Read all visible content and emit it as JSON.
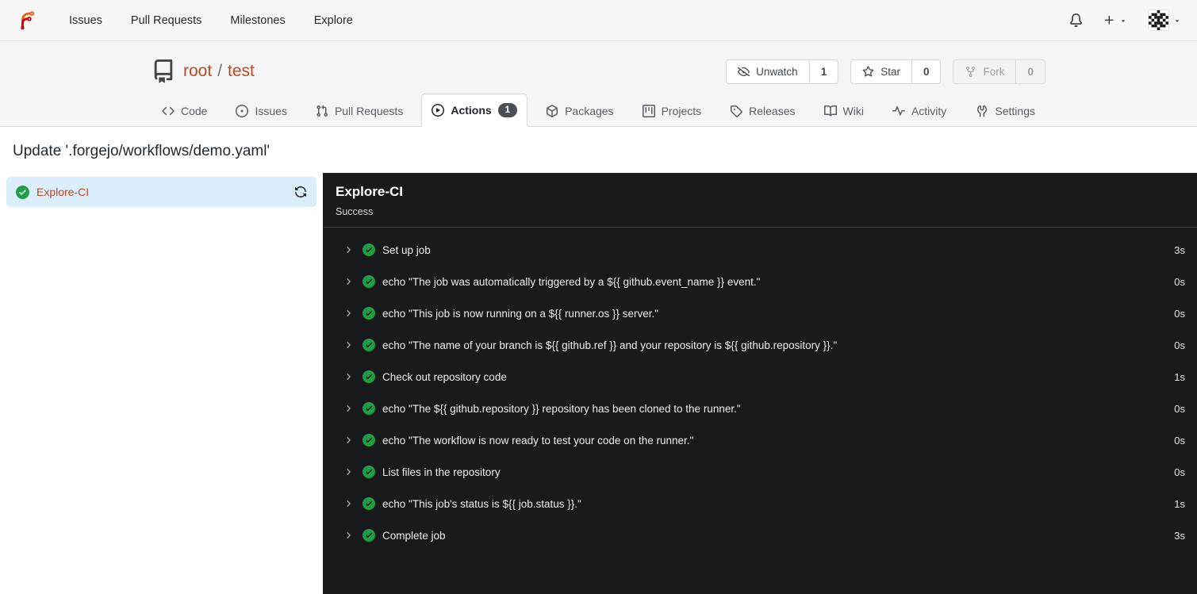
{
  "topnav": {
    "nav_items": [
      {
        "label": "Issues"
      },
      {
        "label": "Pull Requests"
      },
      {
        "label": "Milestones"
      },
      {
        "label": "Explore"
      }
    ],
    "icons": {
      "notifications": "bell-icon",
      "create": "plus-icon",
      "user": "avatar-identicon"
    }
  },
  "repo": {
    "owner": "root",
    "path_separator": "/",
    "name": "test",
    "header_buttons": [
      {
        "label": "Unwatch",
        "count": "1",
        "icon": "eye-slash-icon"
      },
      {
        "label": "Star",
        "count": "0",
        "icon": "star-icon"
      },
      {
        "label": "Fork",
        "count": "0",
        "icon": "fork-icon",
        "disabled": true
      }
    ],
    "tabs": [
      {
        "label": "Code",
        "icon": "code-icon"
      },
      {
        "label": "Issues",
        "icon": "issue-opened-icon"
      },
      {
        "label": "Pull Requests",
        "icon": "pull-request-icon"
      },
      {
        "label": "Actions",
        "icon": "play-circle-icon",
        "badge": "1",
        "active": true
      },
      {
        "label": "Packages",
        "icon": "package-icon"
      },
      {
        "label": "Projects",
        "icon": "project-icon"
      },
      {
        "label": "Releases",
        "icon": "tag-icon"
      },
      {
        "label": "Wiki",
        "icon": "book-icon"
      },
      {
        "label": "Activity",
        "icon": "pulse-icon"
      },
      {
        "label": "Settings",
        "icon": "wrench-icon"
      }
    ]
  },
  "page": {
    "title": "Update '.forgejo/workflows/demo.yaml'"
  },
  "sidebar": {
    "jobs": [
      {
        "name": "Explore-CI",
        "status": "success",
        "status_icon": "check-circle-icon",
        "rerun_icon": "sync-icon"
      }
    ]
  },
  "run": {
    "title": "Explore-CI",
    "status": "Success",
    "steps": [
      {
        "name": "Set up job",
        "duration": "3s"
      },
      {
        "name": "echo \"The job was automatically triggered by a ${{ github.event_name }} event.\"",
        "duration": "0s"
      },
      {
        "name": "echo \"This job is now running on a ${{ runner.os }} server.\"",
        "duration": "0s"
      },
      {
        "name": "echo \"The name of your branch is ${{ github.ref }} and your repository is ${{ github.repository }}.\"",
        "duration": "0s"
      },
      {
        "name": "Check out repository code",
        "duration": "1s"
      },
      {
        "name": "echo \"The ${{ github.repository }} repository has been cloned to the runner.\"",
        "duration": "0s"
      },
      {
        "name": "echo \"The workflow is now ready to test your code on the runner.\"",
        "duration": "0s"
      },
      {
        "name": "List files in the repository",
        "duration": "0s"
      },
      {
        "name": "echo \"This job's status is ${{ job.status }}.\"",
        "duration": "1s"
      },
      {
        "name": "Complete job",
        "duration": "3s"
      }
    ]
  },
  "colors": {
    "accent_link": "#c2491d",
    "success_green": "#1f9e45",
    "panel_bg": "#181a1b",
    "sidebar_selected_bg": "#dbeefc",
    "badge_bg": "#4b5056"
  }
}
